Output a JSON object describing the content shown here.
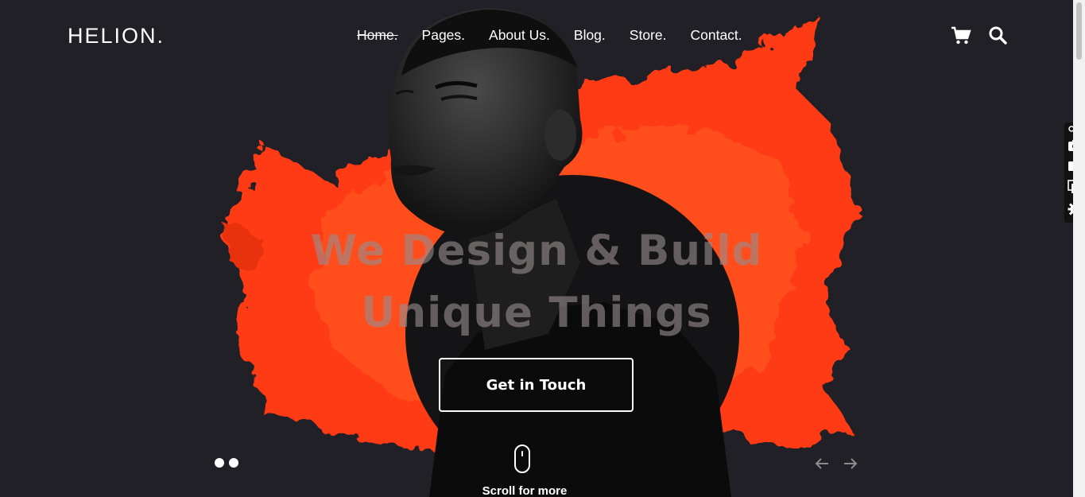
{
  "brand": {
    "logo": "HELION."
  },
  "nav": {
    "items": [
      {
        "label": "Home.",
        "active": true
      },
      {
        "label": "Pages.",
        "active": false
      },
      {
        "label": "About Us.",
        "active": false
      },
      {
        "label": "Blog.",
        "active": false
      },
      {
        "label": "Store.",
        "active": false
      },
      {
        "label": "Contact.",
        "active": false
      }
    ]
  },
  "header_icons": {
    "cart": "cart-icon",
    "search": "search-icon"
  },
  "hero": {
    "headline_line1": "We Design & Build",
    "headline_line2": "Unique Things",
    "cta_label": "Get in Touch",
    "scroll_label": "Scroll for more",
    "slide_count": 2,
    "accent_color": "#ff3a12",
    "background_color": "#222027"
  },
  "side_tools": [
    "link-icon",
    "camera-icon",
    "video-icon",
    "window-icon",
    "settings-icon"
  ]
}
